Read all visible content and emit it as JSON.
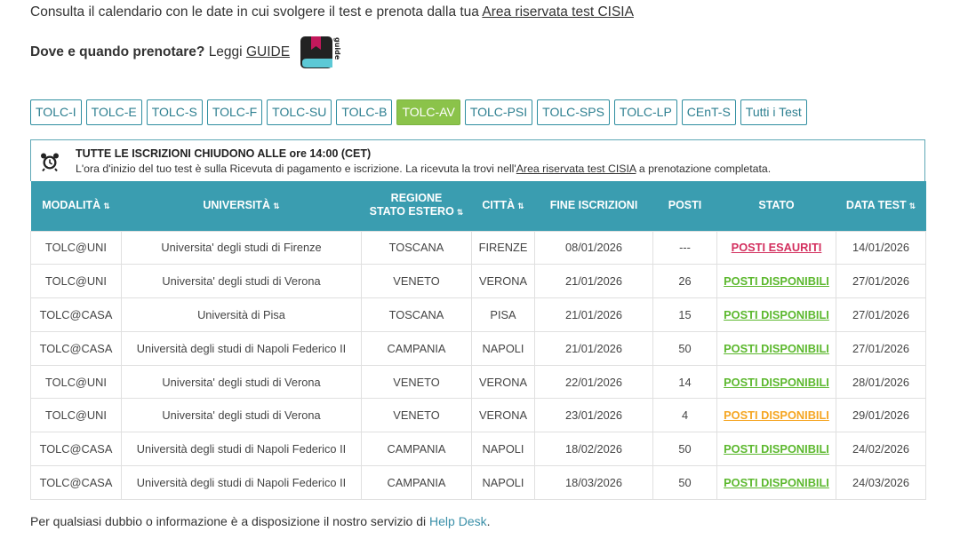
{
  "intro": {
    "text": "Consulta il calendario con le date in cui svolgere il test e prenota dalla tua ",
    "link": "Area riservata test CISIA"
  },
  "guide": {
    "question": "Dove e quando prenotare?",
    "read": "Leggi",
    "link": "GUIDE",
    "icon_text": "guide"
  },
  "tabs": [
    {
      "label": "TOLC-I",
      "active": false
    },
    {
      "label": "TOLC-E",
      "active": false
    },
    {
      "label": "TOLC-S",
      "active": false
    },
    {
      "label": "TOLC-F",
      "active": false
    },
    {
      "label": "TOLC-SU",
      "active": false
    },
    {
      "label": "TOLC-B",
      "active": false
    },
    {
      "label": "TOLC-AV",
      "active": true
    },
    {
      "label": "TOLC-PSI",
      "active": false
    },
    {
      "label": "TOLC-SPS",
      "active": false
    },
    {
      "label": "TOLC-LP",
      "active": false
    },
    {
      "label": "CEnT-S",
      "active": false
    },
    {
      "label": "Tutti i Test",
      "active": false
    }
  ],
  "notice": {
    "title": "TUTTE LE ISCRIZIONI CHIUDONO ALLE ore 14:00 (CET)",
    "text_before": "L'ora d'inizio del tuo test è sulla Ricevuta di pagamento e iscrizione. La ricevuta la trovi nell'",
    "link": "Area riservata test CISIA",
    "text_after": " a prenotazione completata."
  },
  "table": {
    "headers": [
      {
        "label": "MODALITÀ",
        "sortable": true
      },
      {
        "label": "UNIVERSITÀ",
        "sortable": true
      },
      {
        "label": "REGIONE\nSTATO ESTERO",
        "sortable": true
      },
      {
        "label": "CITTÀ",
        "sortable": true
      },
      {
        "label": "FINE ISCRIZIONI",
        "sortable": false
      },
      {
        "label": "POSTI",
        "sortable": false
      },
      {
        "label": "STATO",
        "sortable": false
      },
      {
        "label": "DATA TEST",
        "sortable": true
      }
    ],
    "rows": [
      {
        "modalita": "TOLC@UNI",
        "universita": "Universita' degli studi di Firenze",
        "regione": "TOSCANA",
        "citta": "FIRENZE",
        "fine": "08/01/2026",
        "posti": "---",
        "stato": "POSTI ESAURITI",
        "stato_color": "#d32f5e",
        "data": "14/01/2026"
      },
      {
        "modalita": "TOLC@UNI",
        "universita": "Universita' degli studi di Verona",
        "regione": "VENETO",
        "citta": "VERONA",
        "fine": "21/01/2026",
        "posti": "26",
        "stato": "POSTI DISPONIBILI",
        "stato_color": "#5cb82e",
        "data": "27/01/2026"
      },
      {
        "modalita": "TOLC@CASA",
        "universita": "Università di Pisa",
        "regione": "TOSCANA",
        "citta": "PISA",
        "fine": "21/01/2026",
        "posti": "15",
        "stato": "POSTI DISPONIBILI",
        "stato_color": "#5cb82e",
        "data": "27/01/2026"
      },
      {
        "modalita": "TOLC@CASA",
        "universita": "Università degli studi di Napoli Federico II",
        "regione": "CAMPANIA",
        "citta": "NAPOLI",
        "fine": "21/01/2026",
        "posti": "50",
        "stato": "POSTI DISPONIBILI",
        "stato_color": "#5cb82e",
        "data": "27/01/2026"
      },
      {
        "modalita": "TOLC@UNI",
        "universita": "Universita' degli studi di Verona",
        "regione": "VENETO",
        "citta": "VERONA",
        "fine": "22/01/2026",
        "posti": "14",
        "stato": "POSTI DISPONIBILI",
        "stato_color": "#5cb82e",
        "data": "28/01/2026"
      },
      {
        "modalita": "TOLC@UNI",
        "universita": "Universita' degli studi di Verona",
        "regione": "VENETO",
        "citta": "VERONA",
        "fine": "23/01/2026",
        "posti": "4",
        "stato": "POSTI DISPONIBILI",
        "stato_color": "#f5a623",
        "data": "29/01/2026"
      },
      {
        "modalita": "TOLC@CASA",
        "universita": "Università degli studi di Napoli Federico II",
        "regione": "CAMPANIA",
        "citta": "NAPOLI",
        "fine": "18/02/2026",
        "posti": "50",
        "stato": "POSTI DISPONIBILI",
        "stato_color": "#5cb82e",
        "data": "24/02/2026"
      },
      {
        "modalita": "TOLC@CASA",
        "universita": "Università degli studi di Napoli Federico II",
        "regione": "CAMPANIA",
        "citta": "NAPOLI",
        "fine": "18/03/2026",
        "posti": "50",
        "stato": "POSTI DISPONIBILI",
        "stato_color": "#5cb82e",
        "data": "24/03/2026"
      }
    ]
  },
  "footer": {
    "text": "Per qualsiasi dubbio o informazione è a disposizione il nostro servizio di ",
    "link": "Help Desk",
    "end": "."
  },
  "colors": {
    "header_bg": "#3a9db0",
    "tab_active": "#8bc34a",
    "tab_border": "#2f8ea0",
    "exhausted": "#d32f5e",
    "available": "#5cb82e",
    "low": "#f5a623"
  }
}
